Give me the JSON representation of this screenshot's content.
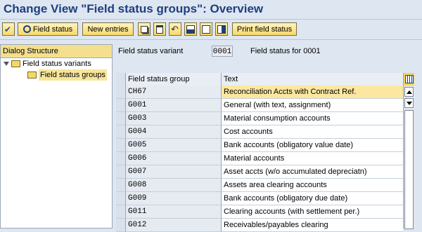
{
  "window": {
    "title": "Change View \"Field status groups\": Overview"
  },
  "toolbar": {
    "field_status_label": "Field status",
    "new_entries_label": "New entries",
    "print_field_status_label": "Print field status"
  },
  "tree": {
    "header": "Dialog Structure",
    "variants_label": "Field status variants",
    "groups_label": "Field status groups"
  },
  "header_fields": {
    "variant_label": "Field status variant",
    "variant_value": "0001",
    "variant_description": "Field status for 0001"
  },
  "table": {
    "columns": [
      "Field status group",
      "Text"
    ],
    "rows": [
      {
        "group": "CH67",
        "text": "Reconciliation Accts with Contract Ref."
      },
      {
        "group": "G001",
        "text": "General (with text, assignment)"
      },
      {
        "group": "G003",
        "text": "Material consumption accounts"
      },
      {
        "group": "G004",
        "text": "Cost accounts"
      },
      {
        "group": "G005",
        "text": "Bank accounts (obligatory value date)"
      },
      {
        "group": "G006",
        "text": "Material accounts"
      },
      {
        "group": "G007",
        "text": "Asset accts (w/o accumulated depreciatn)"
      },
      {
        "group": "G008",
        "text": "Assets area clearing accounts"
      },
      {
        "group": "G009",
        "text": "Bank accounts (obligatory due date)"
      },
      {
        "group": "G011",
        "text": "Clearing accounts (with settlement per.)"
      },
      {
        "group": "G012",
        "text": "Receivables/payables clearing"
      }
    ]
  },
  "colors": {
    "title": "#1f3f7e",
    "highlight_row": "#fbe7a0",
    "button_face": "#f7d96a"
  },
  "icons": [
    "check-icon",
    "search-icon",
    "copy-icon",
    "delete-icon",
    "undo-icon",
    "select-all-icon",
    "deselect-all-icon",
    "select-block-icon",
    "folder-icon",
    "expand-icon",
    "table-settings-icon"
  ]
}
